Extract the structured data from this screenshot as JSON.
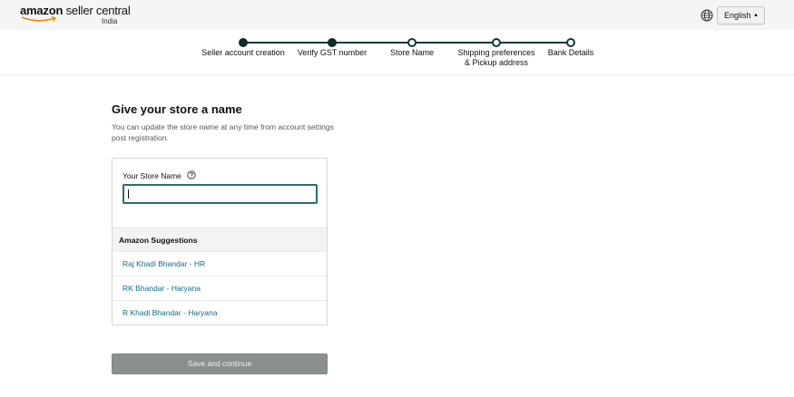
{
  "header": {
    "brand_amazon": "amazon",
    "brand_product": " seller central",
    "brand_country": "India",
    "language": "English"
  },
  "stepper": {
    "steps": [
      {
        "label": "Seller account creation",
        "status": "done"
      },
      {
        "label": "Verify GST number",
        "status": "done"
      },
      {
        "label": "Store Name",
        "status": "current"
      },
      {
        "label_line1": "Shipping preferences",
        "label_line2": "& Pickup address",
        "status": "todo"
      },
      {
        "label": "Bank Details",
        "status": "todo"
      }
    ]
  },
  "main": {
    "title": "Give your store a name",
    "subtitle": "You can update the store name at any time from account settings post registration.",
    "store_name_label": "Your Store Name",
    "store_name_value": "",
    "suggestions_header": "Amazon Suggestions",
    "suggestions": [
      "Raj Khadi Bhandar - HR",
      "RK Bhandar - Haryana",
      "R Khadi Bhandar - Haryana"
    ],
    "save_label": "Save and continue"
  },
  "colors": {
    "accent": "#0f3a3c",
    "link": "#0f6c86",
    "disabled_button": "#8a9090"
  },
  "icons": {
    "language": "globe-icon",
    "help": "question-circle-icon",
    "dropdown": "caret-icon"
  }
}
